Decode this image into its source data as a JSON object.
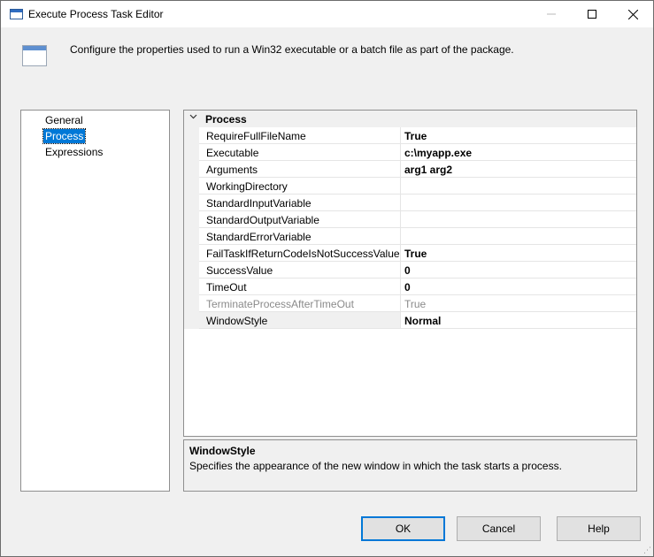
{
  "window": {
    "title": "Execute Process Task Editor",
    "icon": "window-icon"
  },
  "header": {
    "description": "Configure the properties used to run a Win32 executable or a batch file as part of the package."
  },
  "nav": {
    "items": [
      {
        "label": "General",
        "selected": false
      },
      {
        "label": "Process",
        "selected": true
      },
      {
        "label": "Expressions",
        "selected": false
      }
    ]
  },
  "grid": {
    "category": "Process",
    "rows": [
      {
        "name": "RequireFullFileName",
        "value": "True",
        "disabled": false
      },
      {
        "name": "Executable",
        "value": "c:\\myapp.exe",
        "disabled": false
      },
      {
        "name": "Arguments",
        "value": "arg1 arg2",
        "disabled": false
      },
      {
        "name": "WorkingDirectory",
        "value": "",
        "disabled": false
      },
      {
        "name": "StandardInputVariable",
        "value": "",
        "disabled": false
      },
      {
        "name": "StandardOutputVariable",
        "value": "",
        "disabled": false
      },
      {
        "name": "StandardErrorVariable",
        "value": "",
        "disabled": false
      },
      {
        "name": "FailTaskIfReturnCodeIsNotSuccessValue",
        "value": "True",
        "disabled": false
      },
      {
        "name": "SuccessValue",
        "value": "0",
        "disabled": false
      },
      {
        "name": "TimeOut",
        "value": "0",
        "disabled": false
      },
      {
        "name": "TerminateProcessAfterTimeOut",
        "value": "True",
        "disabled": true
      },
      {
        "name": "WindowStyle",
        "value": "Normal",
        "disabled": false,
        "selected": true
      }
    ]
  },
  "description_panel": {
    "title": "WindowStyle",
    "text": "Specifies the appearance of the new window in which the task starts a process."
  },
  "buttons": {
    "ok": "OK",
    "cancel": "Cancel",
    "help": "Help"
  },
  "colors": {
    "selection": "#0078d7",
    "default_button_border": "#0078d7"
  }
}
